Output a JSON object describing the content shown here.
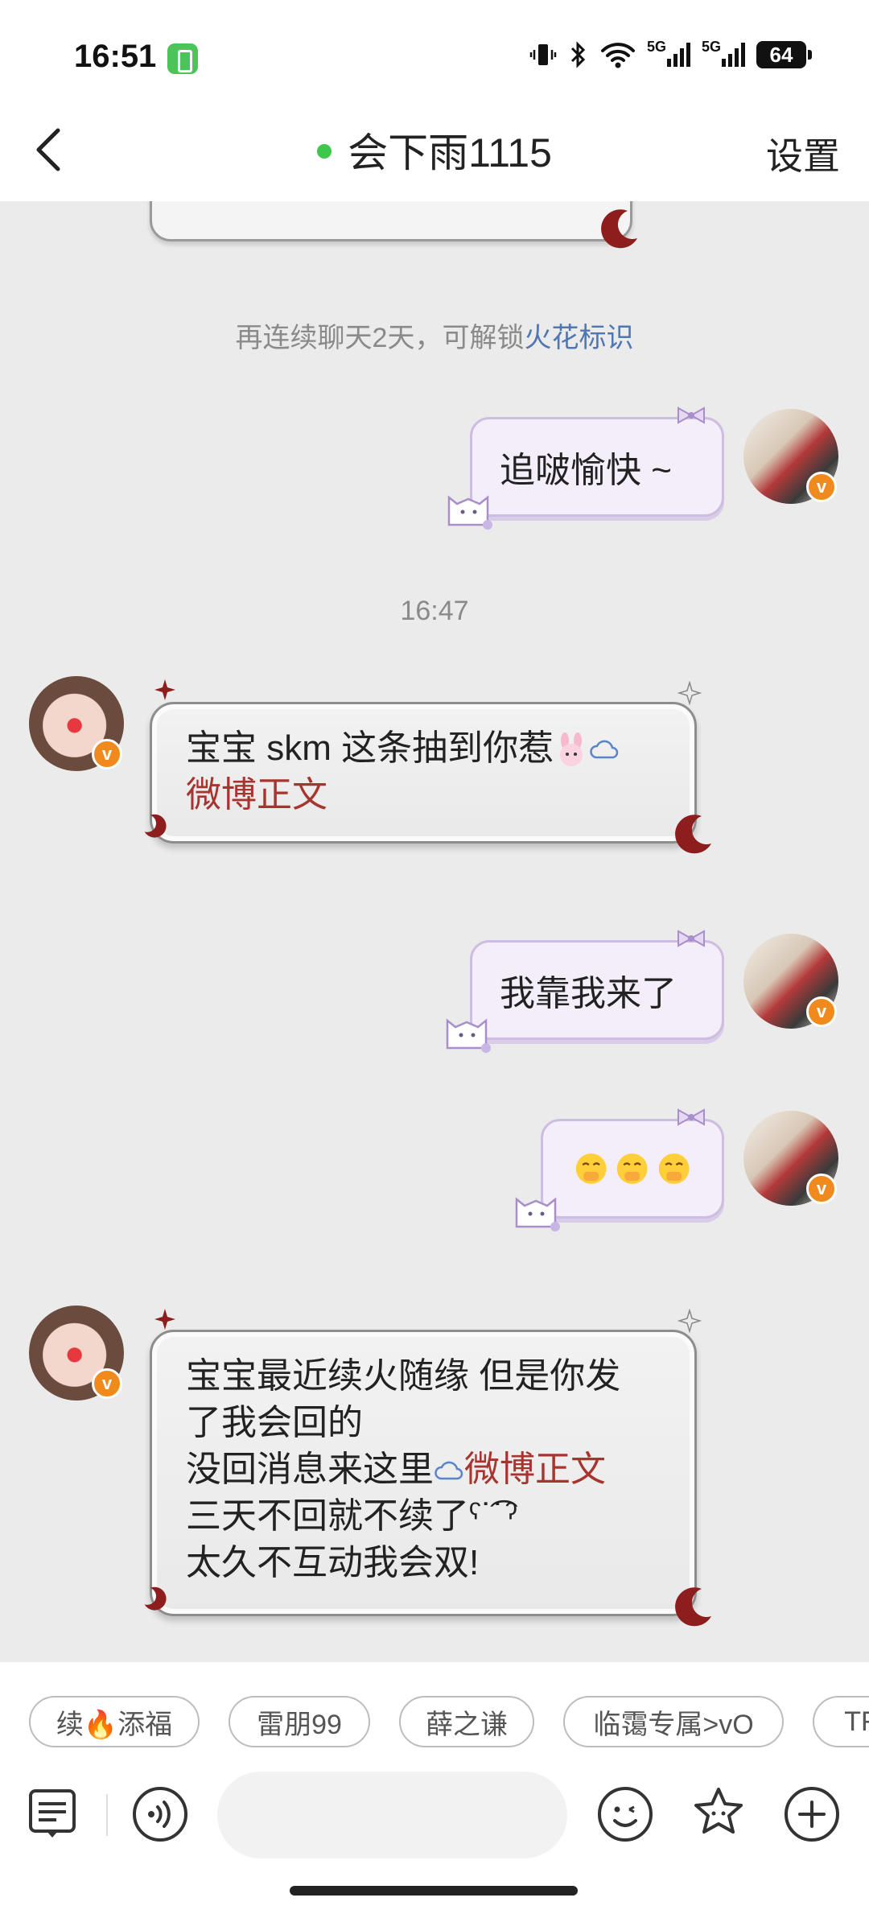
{
  "status_bar": {
    "time": "16:51",
    "battery": "64",
    "signal_label_1": "5G",
    "signal_label_2": "5G"
  },
  "header": {
    "title": "会下雨1115",
    "online": true,
    "settings_label": "设置",
    "online_color": "#3ec74a"
  },
  "messages": {
    "sys_note_prefix": "再连续聊天2天，可解锁",
    "sys_note_link": "火花标识",
    "time_divider": "16:47",
    "m1": "追啵愉快 ~",
    "m2_text": "宝宝 skm 这条抽到你惹",
    "m2_link": "微博正文",
    "m3": "我靠我来了",
    "m4_emojis": [
      "face-hand-over-mouth",
      "face-hand-over-mouth",
      "face-hand-over-mouth"
    ],
    "m5_line1": "宝宝最近续火随缘 但是你发",
    "m5_line2": "了我会回的",
    "m5_line3_prefix": "没回消息来这里",
    "m5_line3_link": "微博正文",
    "m5_line4": "三天不回就不续了ˁ˙͡˙ˀ",
    "m5_line5": "太久不互动我会双!"
  },
  "quick_chips": [
    {
      "label": "续🔥添福"
    },
    {
      "label": "雷朋99"
    },
    {
      "label": "薛之谦"
    },
    {
      "label": "临霭专属>vO"
    },
    {
      "label": "TF"
    }
  ],
  "input_bar": {
    "icons": [
      "notes-icon",
      "voice-icon",
      "emoji-icon",
      "flower-sticker-icon",
      "plus-icon"
    ],
    "placeholder": ""
  },
  "colors": {
    "link_red": "#a6352f",
    "link_blue": "#4f77b2",
    "badge_orange": "#f08a1c",
    "out_bubble": "#f4eefb"
  }
}
